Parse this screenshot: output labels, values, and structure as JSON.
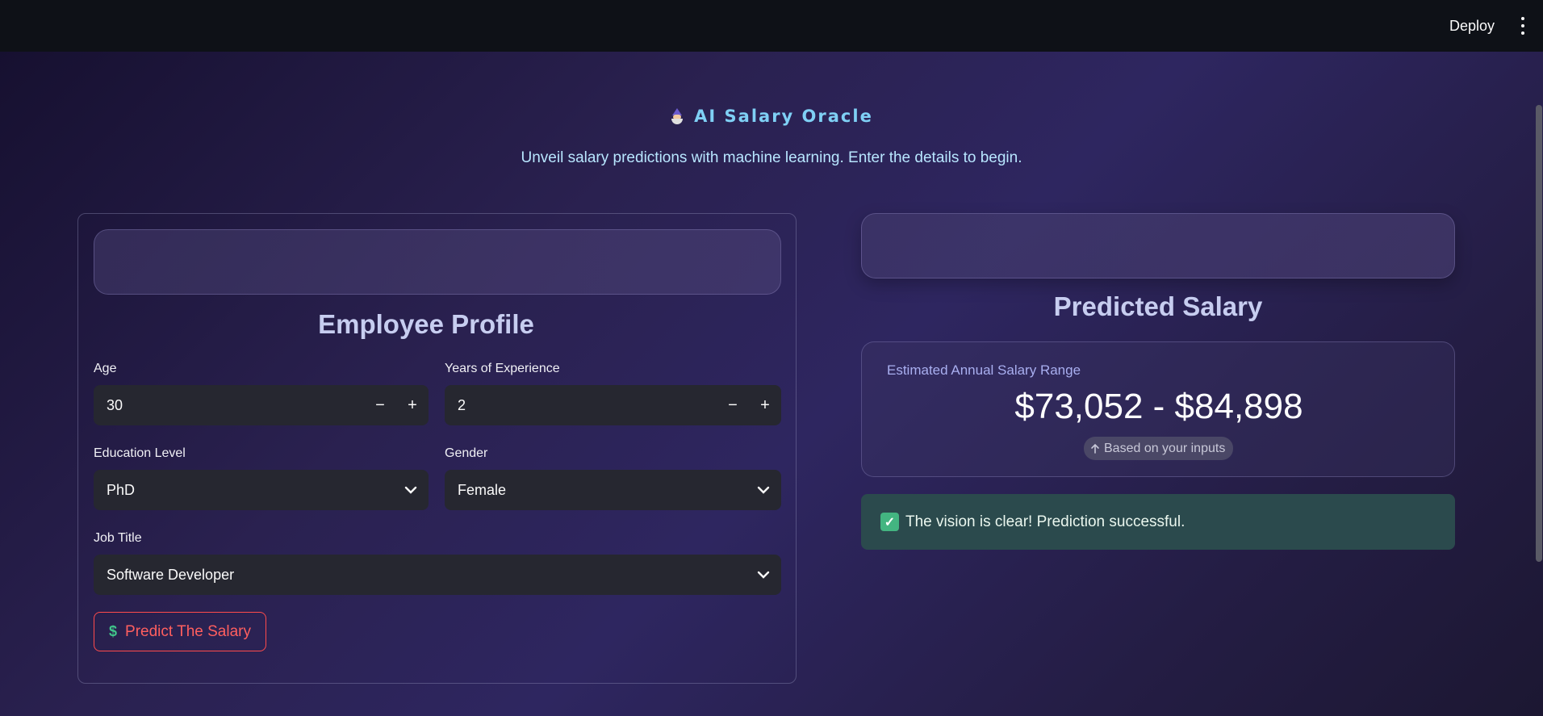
{
  "topbar": {
    "deploy_label": "Deploy",
    "menu_icon": "kebab-menu-icon"
  },
  "header": {
    "icon": "wizard-icon",
    "title": "AI Salary Oracle",
    "subtitle": "Unveil salary predictions with machine learning. Enter the details to begin."
  },
  "profile": {
    "title": "Employee Profile",
    "age": {
      "label": "Age",
      "value": "30",
      "minus": "−",
      "plus": "+"
    },
    "experience": {
      "label": "Years of Experience",
      "value": "2",
      "minus": "−",
      "plus": "+"
    },
    "education": {
      "label": "Education Level",
      "value": "PhD"
    },
    "gender": {
      "label": "Gender",
      "value": "Female"
    },
    "job_title": {
      "label": "Job Title",
      "value": "Software Developer"
    },
    "predict_button": {
      "icon": "dollar-icon",
      "label": "Predict The Salary",
      "border_color": "#ff4b4b"
    }
  },
  "result": {
    "title": "Predicted Salary",
    "range_label": "Estimated Annual Salary Range",
    "range_value": "$73,052 - $84,898",
    "badge": "Based on your inputs",
    "badge_icon": "arrow-up-icon",
    "success_icon": "check-icon",
    "success_message": "The vision is clear! Prediction successful."
  },
  "colors": {
    "topbar": "#0e1117",
    "accent_title": "#7fd0f5",
    "success_bg": "#2b4a4d",
    "input_bg": "#262730"
  }
}
